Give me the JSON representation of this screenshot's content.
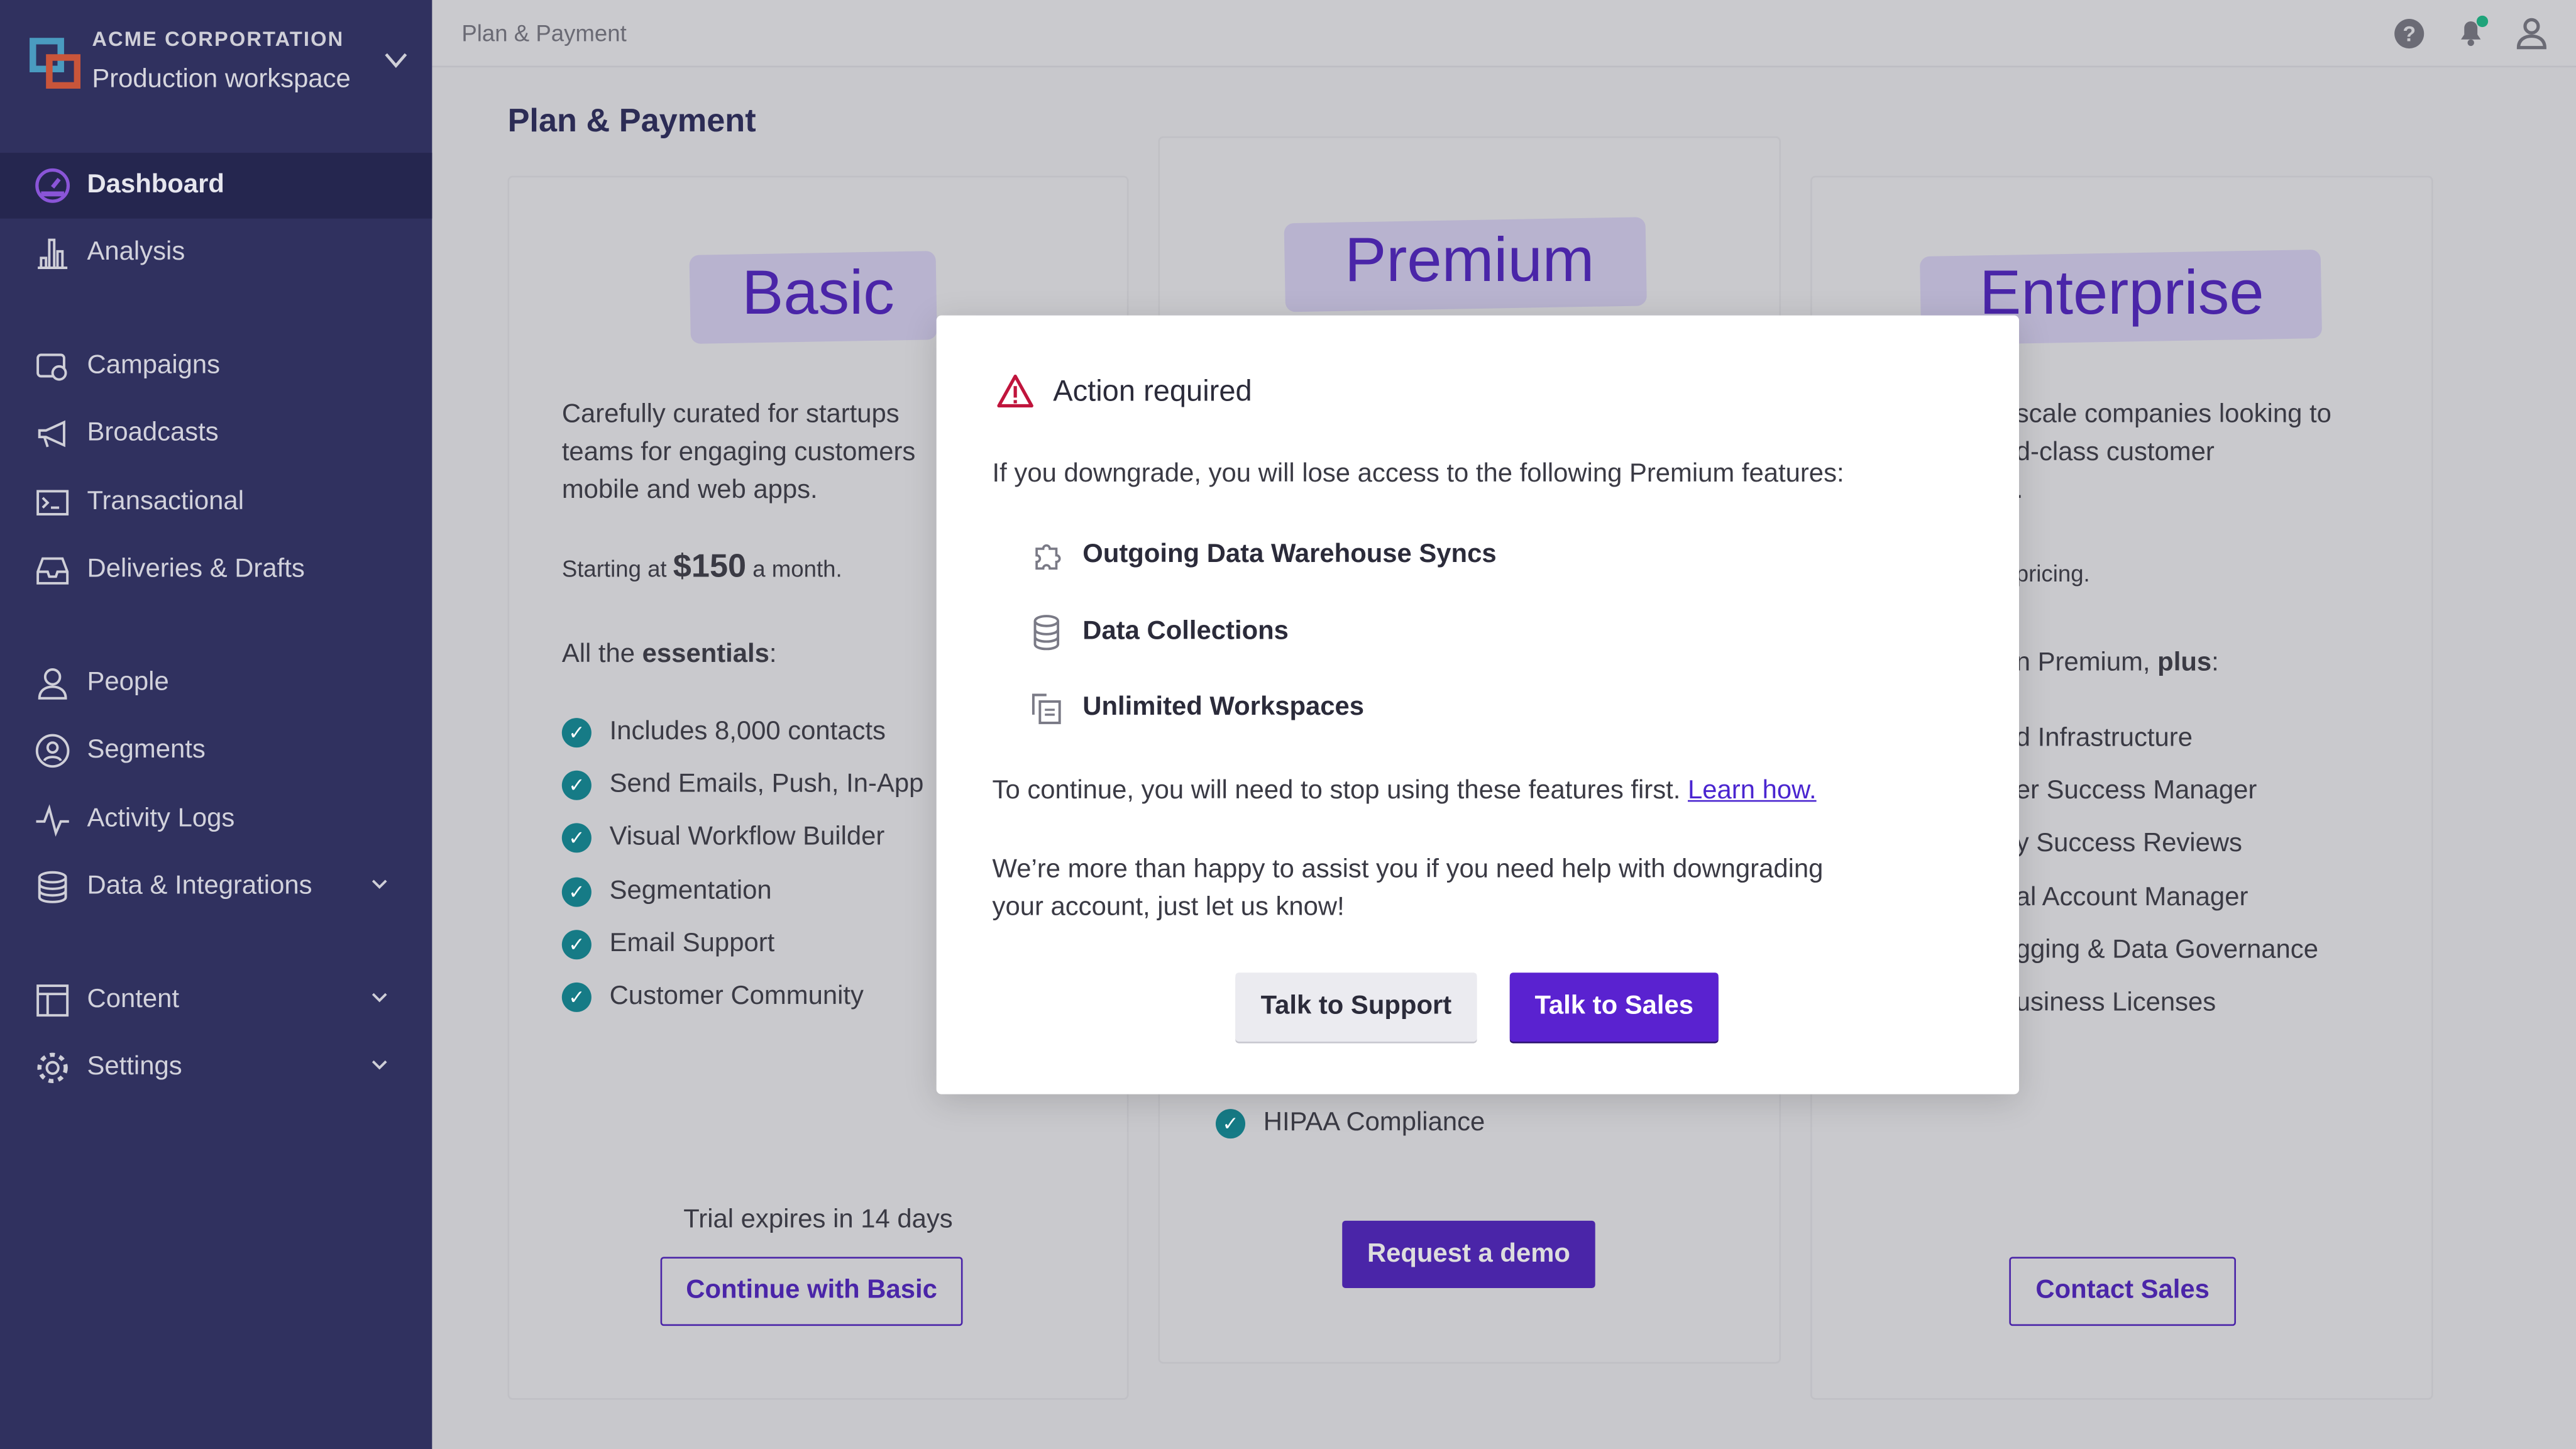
{
  "sidebar": {
    "org": "ACME CORPORTATION",
    "workspace": "Production workspace",
    "items": [
      {
        "label": "Dashboard",
        "icon": "dashboard-gauge-icon",
        "active": true
      },
      {
        "label": "Analysis",
        "icon": "bar-chart-icon"
      },
      {
        "label": "Campaigns",
        "icon": "campaigns-icon"
      },
      {
        "label": "Broadcasts",
        "icon": "megaphone-icon"
      },
      {
        "label": "Transactional",
        "icon": "terminal-icon"
      },
      {
        "label": "Deliveries & Drafts",
        "icon": "inbox-icon"
      },
      {
        "label": "People",
        "icon": "person-icon"
      },
      {
        "label": "Segments",
        "icon": "segments-icon"
      },
      {
        "label": "Activity Logs",
        "icon": "pulse-icon"
      },
      {
        "label": "Data & Integrations",
        "icon": "database-icon",
        "expandable": true
      },
      {
        "label": "Content",
        "icon": "layout-icon",
        "expandable": true
      },
      {
        "label": "Settings",
        "icon": "gear-icon",
        "expandable": true
      }
    ]
  },
  "topbar": {
    "breadcrumb": "Plan & Payment",
    "notification_dot_color": "#1fa37a"
  },
  "page": {
    "title": "Plan & Payment"
  },
  "plans": {
    "basic": {
      "name": "Basic",
      "description": [
        "Carefully curated for startups",
        "teams for engaging customers",
        "mobile and web apps."
      ],
      "price_prefix": "Starting at",
      "price": "$150",
      "price_suffix": "a month.",
      "features_intro": "All the",
      "features_intro_bold": "essentials",
      "features_intro_end": ":",
      "features": [
        "Includes 8,000 contacts",
        "Send Emails, Push, In-App",
        "Visual Workflow Builder",
        "Segmentation",
        "Email Support",
        "Customer Community"
      ],
      "trial": "Trial expires in 14 days",
      "button": "Continue with Basic"
    },
    "premium": {
      "name": "Premium",
      "features": [
        "HIPAA Compliance"
      ],
      "button": "Request a demo"
    },
    "enterprise": {
      "name": "Enterprise",
      "description": [
        "scale companies looking to",
        "d-class customer",
        "."
      ],
      "price_text": "pricing.",
      "features_intro": "n Premium,",
      "features_intro_bold": "plus",
      "features_intro_end": ":",
      "features": [
        "d Infrastructure",
        "er Success Manager",
        "y Success Reviews",
        "al Account Manager",
        "gging & Data Governance",
        "usiness Licenses"
      ],
      "button": "Contact Sales"
    }
  },
  "modal": {
    "title": "Action required",
    "intro": "If you downgrade, you will lose access to the following Premium features:",
    "features": [
      {
        "label": "Outgoing Data Warehouse Syncs",
        "icon": "puzzle-icon"
      },
      {
        "label": "Data Collections",
        "icon": "database-icon"
      },
      {
        "label": "Unlimited Workspaces",
        "icon": "workspaces-icon"
      }
    ],
    "continue_text": "To continue, you will need to stop using these features first.",
    "learn_link": "Learn how.",
    "help_text_1": "We’re more than happy to assist you if you need help with downgrading",
    "help_text_2": "your account, just let us know!",
    "support_button": "Talk to Support",
    "sales_button": "Talk to Sales"
  },
  "colors": {
    "accent": "#4a25a8",
    "sales_button": "#5a22d0",
    "check": "#167b86",
    "warning": "#c0143c"
  }
}
